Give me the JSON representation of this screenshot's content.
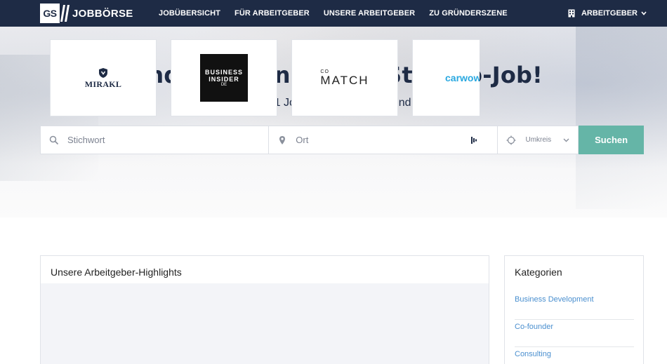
{
  "header": {
    "logo_box": "GS",
    "logo_text": "JOBBÖRSE",
    "nav": [
      "JOBÜBERSICHT",
      "FÜR ARBEITGEBER",
      "UNSERE ARBEITGEBER",
      "ZU GRÜNDERSZENE"
    ],
    "employer_label": "ARBEITGEBER"
  },
  "hero": {
    "title": "Finde deinen neuen Startup-Job!",
    "subtitle": "Die Nummer 1 Jobbörse für Startup- und Digital-Jobs"
  },
  "search": {
    "keyword_placeholder": "Stichwort",
    "location_placeholder": "Ort",
    "radius_label": "Umkreis",
    "button_label": "Suchen"
  },
  "highlights": {
    "title": "Unsere Arbeitgeber-Highlights",
    "employers": [
      {
        "name": "MIRAKL"
      },
      {
        "name_line1": "BUSINESS",
        "name_line2": "INSIDER",
        "name_line3": "DE"
      },
      {
        "name_top": "CO",
        "name": "MATCH"
      },
      {
        "name": "carwow"
      }
    ]
  },
  "categories": {
    "title": "Kategorien",
    "items": [
      "Business Development",
      "Co-founder",
      "Consulting"
    ]
  },
  "colors": {
    "navbar": "#1e2b45",
    "accent_button": "#65b5a7",
    "link": "#4a8fcf",
    "carwow": "#29a8e0"
  }
}
